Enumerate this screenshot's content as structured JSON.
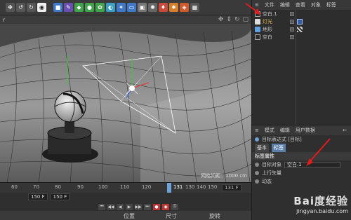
{
  "toolbar": {
    "icons": [
      "move-icon",
      "undo-icon",
      "redo-icon",
      "render-icon",
      "cube-icon",
      "pen-icon",
      "deformer-icon",
      "generator-icon",
      "nurbs-icon",
      "mograph-icon",
      "hair-icon",
      "floor-icon",
      "camera-icon",
      "light-icon",
      "tag-icon",
      "sculpt-icon",
      "script-icon",
      "layout-icon"
    ]
  },
  "viewport": {
    "corner_label": "r",
    "info": "网格间距：1000 cm"
  },
  "timeline": {
    "ruler": [
      "60",
      "70",
      "80",
      "90",
      "100",
      "110",
      "120",
      "130",
      "140",
      "150"
    ],
    "current_frame": "131",
    "end_frame": "131 F",
    "frame_field_left": "150 F",
    "frame_field_right": "150 F"
  },
  "coords": {
    "position": "位置",
    "size": "尺寸",
    "rotation": "旋转"
  },
  "object_manager": {
    "menu": [
      "文件",
      "编辑",
      "查看",
      "对象",
      "标签"
    ],
    "items": [
      {
        "label": "空白.1",
        "color": "#c9c9c9"
      },
      {
        "label": "灯光",
        "color": "#e3b84b"
      },
      {
        "label": "地形",
        "color": "#c9c9c9"
      },
      {
        "label": "空白",
        "color": "#c9c9c9"
      }
    ]
  },
  "attributes": {
    "menu": [
      "模式",
      "编辑",
      "用户数据"
    ],
    "title": "目标表达式 [目标]",
    "tabs": [
      "基本",
      "标签"
    ],
    "section": "标签属性",
    "rows": [
      {
        "label": "目标对象",
        "value": "空白.1"
      },
      {
        "label": "上行矢量",
        "value": ""
      },
      {
        "label": "动态",
        "value": ""
      }
    ]
  },
  "watermark": {
    "logo": "Bai度经验",
    "url": "jingyan.baidu.com"
  }
}
